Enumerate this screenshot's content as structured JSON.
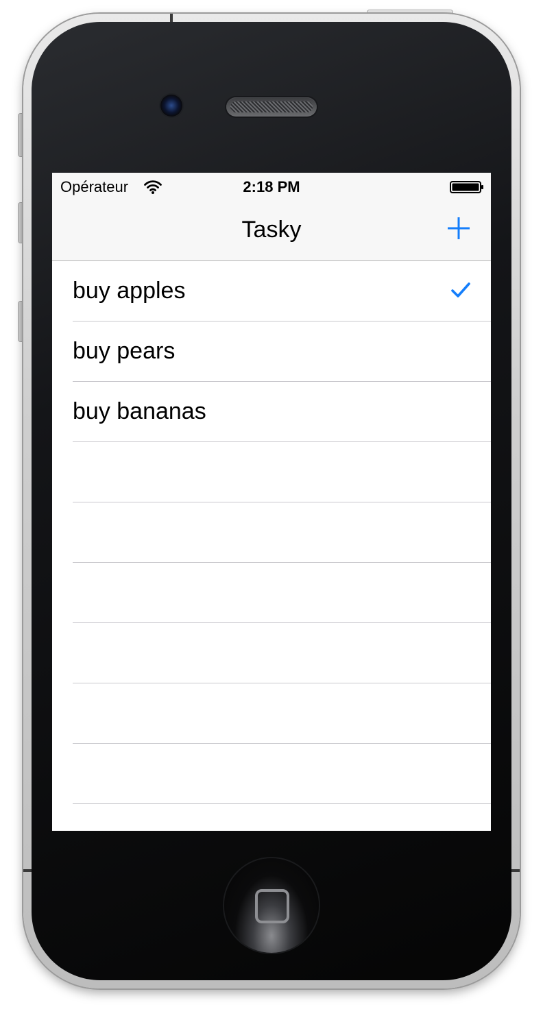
{
  "status_bar": {
    "carrier": "Opérateur",
    "time": "2:18 PM",
    "icons": [
      "wifi-icon",
      "battery-icon"
    ]
  },
  "nav_bar": {
    "title": "Tasky",
    "add_icon": "plus-icon"
  },
  "tasks": [
    {
      "label": "buy apples",
      "done": true
    },
    {
      "label": "buy pears",
      "done": false
    },
    {
      "label": "buy bananas",
      "done": false
    }
  ],
  "colors": {
    "accent": "#147efb",
    "bar_background": "#f7f7f7",
    "separator": "#c8c7cc"
  },
  "device": {
    "home_button_icon": "home-square-icon"
  }
}
